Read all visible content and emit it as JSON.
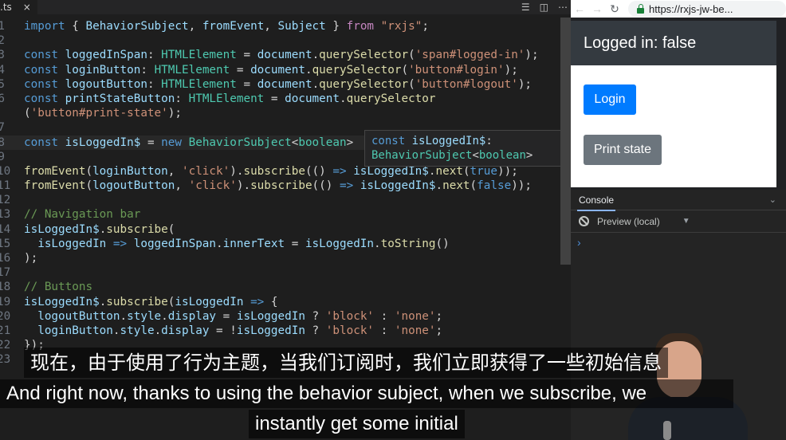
{
  "editor": {
    "tab_label": ".ts",
    "tab_close": "×",
    "toolbar_icons": [
      "split-preview-icon",
      "split-editor-icon",
      "more-actions-icon"
    ],
    "lines": [
      {
        "n": "1",
        "parts": [
          [
            "k",
            "import"
          ],
          [
            "d",
            " { "
          ],
          [
            "i",
            "BehaviorSubject"
          ],
          [
            "d",
            ", "
          ],
          [
            "i",
            "fromEvent"
          ],
          [
            "d",
            ", "
          ],
          [
            "i",
            "Subject"
          ],
          [
            "d",
            " } "
          ],
          [
            "p",
            "from"
          ],
          [
            "d",
            " "
          ],
          [
            "s",
            "\"rxjs\""
          ],
          [
            "d",
            ";"
          ]
        ]
      },
      {
        "n": "2",
        "parts": []
      },
      {
        "n": "3",
        "parts": [
          [
            "k",
            "const"
          ],
          [
            "d",
            " "
          ],
          [
            "i",
            "loggedInSpan"
          ],
          [
            "d",
            ": "
          ],
          [
            "t",
            "HTMLElement"
          ],
          [
            "d",
            " = "
          ],
          [
            "i",
            "document"
          ],
          [
            "d",
            "."
          ],
          [
            "f",
            "querySelector"
          ],
          [
            "d",
            "("
          ],
          [
            "s",
            "'span#logged-in'"
          ],
          [
            "d",
            ");"
          ]
        ]
      },
      {
        "n": "4",
        "parts": [
          [
            "k",
            "const"
          ],
          [
            "d",
            " "
          ],
          [
            "i",
            "loginButton"
          ],
          [
            "d",
            ": "
          ],
          [
            "t",
            "HTMLElement"
          ],
          [
            "d",
            " = "
          ],
          [
            "i",
            "document"
          ],
          [
            "d",
            "."
          ],
          [
            "f",
            "querySelector"
          ],
          [
            "d",
            "("
          ],
          [
            "s",
            "'button#login'"
          ],
          [
            "d",
            ");"
          ]
        ]
      },
      {
        "n": "5",
        "parts": [
          [
            "k",
            "const"
          ],
          [
            "d",
            " "
          ],
          [
            "i",
            "logoutButton"
          ],
          [
            "d",
            ": "
          ],
          [
            "t",
            "HTMLElement"
          ],
          [
            "d",
            " = "
          ],
          [
            "i",
            "document"
          ],
          [
            "d",
            "."
          ],
          [
            "f",
            "querySelector"
          ],
          [
            "d",
            "("
          ],
          [
            "s",
            "'button#logout'"
          ],
          [
            "d",
            ");"
          ]
        ]
      },
      {
        "n": "6",
        "parts": [
          [
            "k",
            "const"
          ],
          [
            "d",
            " "
          ],
          [
            "i",
            "printStateButton"
          ],
          [
            "d",
            ": "
          ],
          [
            "t",
            "HTMLElement"
          ],
          [
            "d",
            " = "
          ],
          [
            "i",
            "document"
          ],
          [
            "d",
            "."
          ],
          [
            "f",
            "querySelector"
          ]
        ]
      },
      {
        "n": "",
        "parts": [
          [
            "d",
            "("
          ],
          [
            "s",
            "'button#print-state'"
          ],
          [
            "d",
            ");"
          ]
        ]
      },
      {
        "n": "7",
        "parts": []
      },
      {
        "n": "8",
        "current": true,
        "parts": [
          [
            "k",
            "const"
          ],
          [
            "d",
            " "
          ],
          [
            "i",
            "isLoggedIn$"
          ],
          [
            "d",
            " = "
          ],
          [
            "k",
            "new"
          ],
          [
            "d",
            " "
          ],
          [
            "t",
            "BehaviorSubject"
          ],
          [
            "d",
            "<"
          ],
          [
            "t",
            "boolean"
          ],
          [
            "d",
            ">"
          ]
        ]
      },
      {
        "n": "9",
        "parts": []
      },
      {
        "n": "10",
        "parts": [
          [
            "f",
            "fromEvent"
          ],
          [
            "d",
            "("
          ],
          [
            "i",
            "loginButton"
          ],
          [
            "d",
            ", "
          ],
          [
            "s",
            "'click'"
          ],
          [
            "d",
            ")."
          ],
          [
            "f",
            "subscribe"
          ],
          [
            "d",
            "(() "
          ],
          [
            "k",
            "=>"
          ],
          [
            "d",
            " "
          ],
          [
            "i",
            "isLoggedIn$"
          ],
          [
            "d",
            "."
          ],
          [
            "f",
            "next"
          ],
          [
            "d",
            "("
          ],
          [
            "k",
            "true"
          ],
          [
            "d",
            "));"
          ]
        ]
      },
      {
        "n": "11",
        "parts": [
          [
            "f",
            "fromEvent"
          ],
          [
            "d",
            "("
          ],
          [
            "i",
            "logoutButton"
          ],
          [
            "d",
            ", "
          ],
          [
            "s",
            "'click'"
          ],
          [
            "d",
            ")."
          ],
          [
            "f",
            "subscribe"
          ],
          [
            "d",
            "(() "
          ],
          [
            "k",
            "=>"
          ],
          [
            "d",
            " "
          ],
          [
            "i",
            "isLoggedIn$"
          ],
          [
            "d",
            "."
          ],
          [
            "f",
            "next"
          ],
          [
            "d",
            "("
          ],
          [
            "k",
            "false"
          ],
          [
            "d",
            "));"
          ]
        ]
      },
      {
        "n": "12",
        "parts": []
      },
      {
        "n": "13",
        "parts": [
          [
            "c",
            "// Navigation bar"
          ]
        ]
      },
      {
        "n": "14",
        "parts": [
          [
            "i",
            "isLoggedIn$"
          ],
          [
            "d",
            "."
          ],
          [
            "f",
            "subscribe"
          ],
          [
            "d",
            "("
          ]
        ]
      },
      {
        "n": "15",
        "parts": [
          [
            "d",
            "  "
          ],
          [
            "i",
            "isLoggedIn"
          ],
          [
            "d",
            " "
          ],
          [
            "k",
            "=>"
          ],
          [
            "d",
            " "
          ],
          [
            "i",
            "loggedInSpan"
          ],
          [
            "d",
            "."
          ],
          [
            "i",
            "innerText"
          ],
          [
            "d",
            " = "
          ],
          [
            "i",
            "isLoggedIn"
          ],
          [
            "d",
            "."
          ],
          [
            "f",
            "toString"
          ],
          [
            "d",
            "()"
          ]
        ]
      },
      {
        "n": "16",
        "parts": [
          [
            "d",
            ");"
          ]
        ]
      },
      {
        "n": "17",
        "parts": []
      },
      {
        "n": "18",
        "parts": [
          [
            "c",
            "// Buttons"
          ]
        ]
      },
      {
        "n": "19",
        "parts": [
          [
            "i",
            "isLoggedIn$"
          ],
          [
            "d",
            "."
          ],
          [
            "f",
            "subscribe"
          ],
          [
            "d",
            "("
          ],
          [
            "i",
            "isLoggedIn"
          ],
          [
            "d",
            " "
          ],
          [
            "k",
            "=>"
          ],
          [
            "d",
            " {"
          ]
        ]
      },
      {
        "n": "20",
        "parts": [
          [
            "d",
            "  "
          ],
          [
            "i",
            "logoutButton"
          ],
          [
            "d",
            "."
          ],
          [
            "i",
            "style"
          ],
          [
            "d",
            "."
          ],
          [
            "i",
            "display"
          ],
          [
            "d",
            " = "
          ],
          [
            "i",
            "isLoggedIn"
          ],
          [
            "d",
            " ? "
          ],
          [
            "s",
            "'block'"
          ],
          [
            "d",
            " : "
          ],
          [
            "s",
            "'none'"
          ],
          [
            "d",
            ";"
          ]
        ]
      },
      {
        "n": "21",
        "parts": [
          [
            "d",
            "  "
          ],
          [
            "i",
            "loginButton"
          ],
          [
            "d",
            "."
          ],
          [
            "i",
            "style"
          ],
          [
            "d",
            "."
          ],
          [
            "i",
            "display"
          ],
          [
            "d",
            " = !"
          ],
          [
            "i",
            "isLoggedIn"
          ],
          [
            "d",
            " ? "
          ],
          [
            "s",
            "'block'"
          ],
          [
            "d",
            " : "
          ],
          [
            "s",
            "'none'"
          ],
          [
            "d",
            ";"
          ]
        ]
      },
      {
        "n": "22",
        "parts": [
          [
            "d",
            "});"
          ]
        ]
      },
      {
        "n": "23",
        "parts": []
      }
    ],
    "tooltip": {
      "line1": [
        [
          "k",
          "const"
        ],
        [
          "d",
          " "
        ],
        [
          "i",
          "isLoggedIn$"
        ],
        [
          "d",
          ":"
        ]
      ],
      "line2": [
        [
          "t",
          "BehaviorSubject"
        ],
        [
          "d",
          "<"
        ],
        [
          "t",
          "boolean"
        ],
        [
          "d",
          ">"
        ]
      ]
    }
  },
  "browser": {
    "back": "←",
    "forward": "→",
    "reload": "↻",
    "url": "https://rxjs-jw-be...",
    "navbar_text": "Logged in: false",
    "login_label": "Login",
    "print_label": "Print state",
    "devtools": {
      "tab": "Console",
      "tab_chevron": "⌄",
      "context": "Preview (local)",
      "context_arrow": "▼",
      "prompt": "›"
    }
  },
  "subtitles": {
    "zh": "现在，由于使用了行为主题，当我们订阅时，我们立即获得了一些初始信息",
    "en_line1": "And right now, thanks to using the behavior subject, when we subscribe, we",
    "en_line2": "instantly get some initial"
  }
}
